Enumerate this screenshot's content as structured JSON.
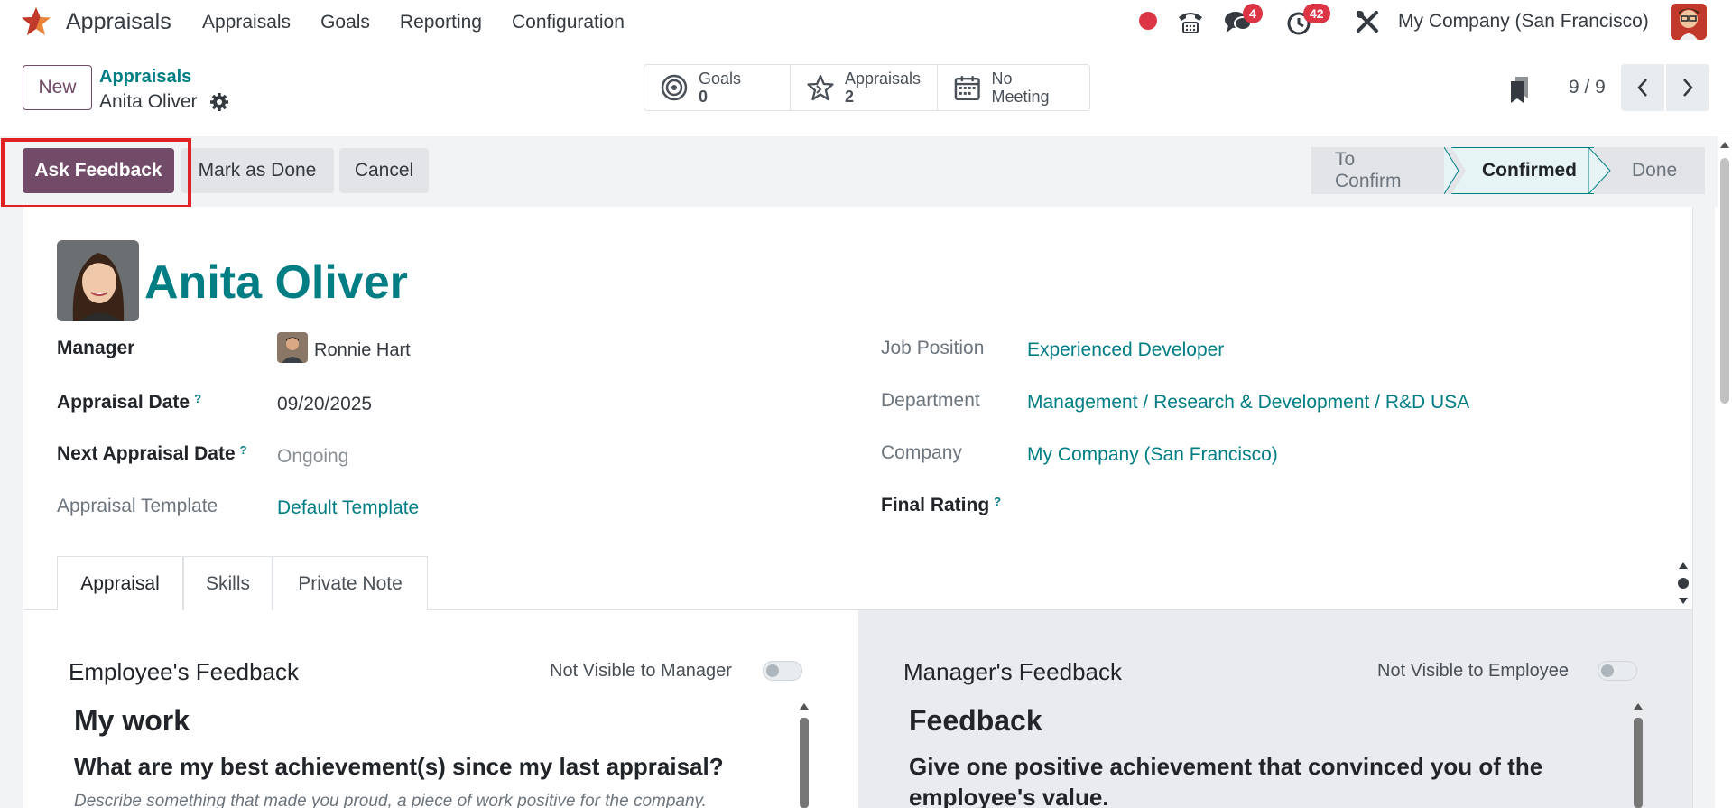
{
  "navbar": {
    "app_name": "Appraisals",
    "menu": [
      "Appraisals",
      "Goals",
      "Reporting",
      "Configuration"
    ],
    "chat_badge": "4",
    "activity_badge": "42",
    "company": "My Company (San Francisco)"
  },
  "control_panel": {
    "new_label": "New",
    "breadcrumb_parent": "Appraisals",
    "breadcrumb_current": "Anita Oliver",
    "smart_buttons": [
      {
        "label": "Goals",
        "value": "0",
        "icon": "target-icon"
      },
      {
        "label": "Appraisals",
        "value": "2",
        "icon": "star-icon"
      },
      {
        "label": "No Meeting",
        "value": "",
        "icon": "calendar-icon"
      }
    ],
    "pager": "9 / 9"
  },
  "actions": {
    "ask_feedback": "Ask Feedback",
    "mark_done": "Mark as Done",
    "cancel": "Cancel"
  },
  "statusbar": {
    "stages": [
      "To Confirm",
      "Confirmed",
      "Done"
    ],
    "active": "Confirmed"
  },
  "record": {
    "employee_name": "Anita Oliver",
    "fields_left": [
      {
        "label": "Manager",
        "value": "Ronnie Hart",
        "help": ""
      },
      {
        "label": "Appraisal Date",
        "value": "09/20/2025",
        "help": "?"
      },
      {
        "label": "Next Appraisal Date",
        "value": "Ongoing",
        "help": "?"
      },
      {
        "label": "Appraisal Template",
        "value": "Default Template",
        "help": ""
      }
    ],
    "fields_right": [
      {
        "label": "Job Position",
        "value": "Experienced Developer",
        "help": ""
      },
      {
        "label": "Department",
        "value": "Management / Research & Development / R&D USA",
        "help": ""
      },
      {
        "label": "Company",
        "value": "My Company (San Francisco)",
        "help": ""
      },
      {
        "label": "Final Rating",
        "value": "",
        "help": "?"
      }
    ]
  },
  "tabs": [
    "Appraisal",
    "Skills",
    "Private Note"
  ],
  "employee_feedback": {
    "title": "Employee's Feedback",
    "toggle_label": "Not Visible to Manager",
    "heading": "My work",
    "question": "What are my best achievement(s) since my last appraisal?",
    "hint": "Describe something that made you proud, a piece of work positive for the company."
  },
  "manager_feedback": {
    "title": "Manager's Feedback",
    "toggle_label": "Not Visible to Employee",
    "heading": "Feedback",
    "question": "Give one positive achievement that convinced you of the employee's value."
  },
  "colors": {
    "brand": "#714b67",
    "link": "#017e84",
    "danger": "#dc3545",
    "highlight": "#e02222"
  }
}
